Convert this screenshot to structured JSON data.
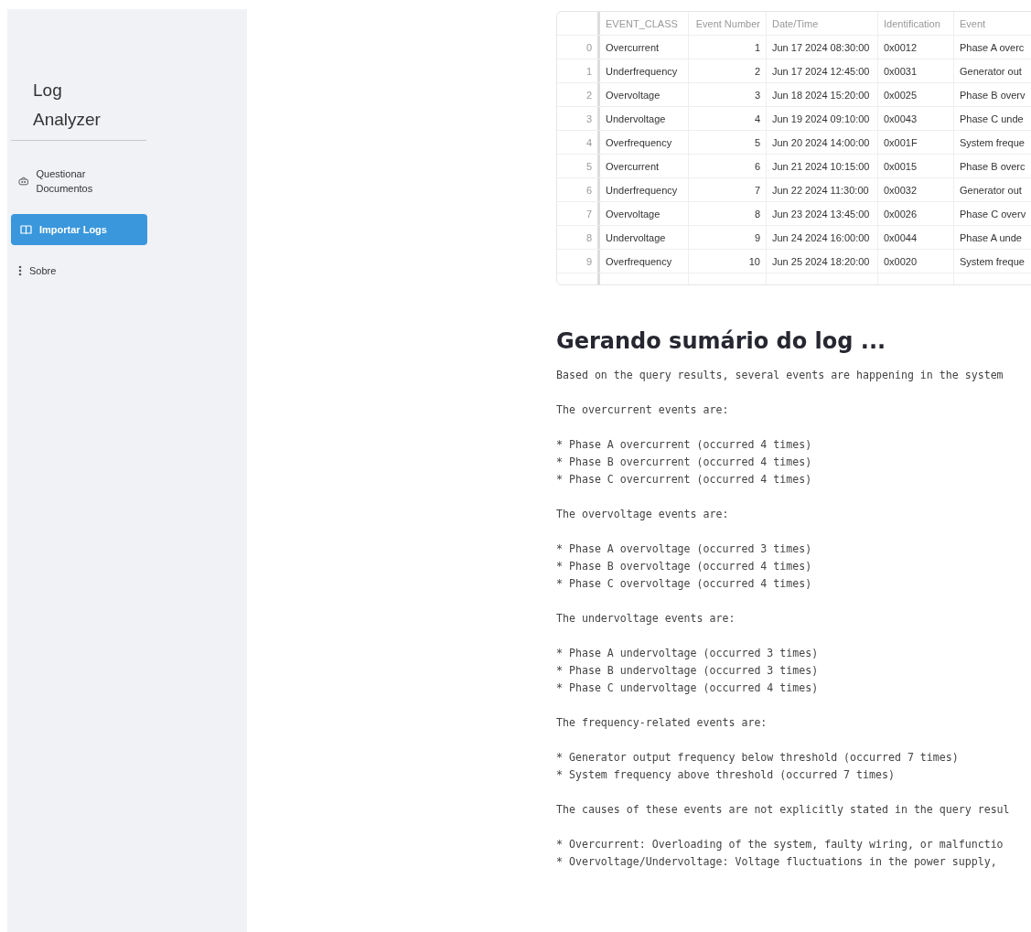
{
  "sidebar": {
    "title": "Log Analyzer",
    "items": [
      {
        "label": "Questionar Documentos",
        "kind": "robot",
        "selected": false
      },
      {
        "label": "Importar Logs",
        "kind": "book",
        "selected": true
      },
      {
        "label": "Sobre",
        "kind": "dots",
        "selected": false
      }
    ]
  },
  "table": {
    "columns": [
      "EVENT_CLASS",
      "Event Number",
      "Date/Time",
      "Identification",
      "Event"
    ],
    "rows": [
      {
        "index": "0",
        "cells": [
          "Overcurrent",
          "1",
          "Jun 17 2024 08:30:00",
          "0x0012",
          "Phase A overc"
        ]
      },
      {
        "index": "1",
        "cells": [
          "Underfrequency",
          "2",
          "Jun 17 2024 12:45:00",
          "0x0031",
          "Generator out"
        ]
      },
      {
        "index": "2",
        "cells": [
          "Overvoltage",
          "3",
          "Jun 18 2024 15:20:00",
          "0x0025",
          "Phase B overv"
        ]
      },
      {
        "index": "3",
        "cells": [
          "Undervoltage",
          "4",
          "Jun 19 2024 09:10:00",
          "0x0043",
          "Phase C unde"
        ]
      },
      {
        "index": "4",
        "cells": [
          "Overfrequency",
          "5",
          "Jun 20 2024 14:00:00",
          "0x001F",
          "System freque"
        ]
      },
      {
        "index": "5",
        "cells": [
          "Overcurrent",
          "6",
          "Jun 21 2024 10:15:00",
          "0x0015",
          "Phase B overc"
        ]
      },
      {
        "index": "6",
        "cells": [
          "Underfrequency",
          "7",
          "Jun 22 2024 11:30:00",
          "0x0032",
          "Generator out"
        ]
      },
      {
        "index": "7",
        "cells": [
          "Overvoltage",
          "8",
          "Jun 23 2024 13:45:00",
          "0x0026",
          "Phase C overv"
        ]
      },
      {
        "index": "8",
        "cells": [
          "Undervoltage",
          "9",
          "Jun 24 2024 16:00:00",
          "0x0044",
          "Phase A unde"
        ]
      },
      {
        "index": "9",
        "cells": [
          "Overfrequency",
          "10",
          "Jun 25 2024 18:20:00",
          "0x0020",
          "System freque"
        ]
      }
    ]
  },
  "summary": {
    "heading": "Gerando sumário do log ...",
    "blocks": [
      {
        "kind": "paragraph",
        "text": "Based on the query results, several events are happening in the system"
      },
      {
        "kind": "paragraph",
        "text": "The overcurrent events are:"
      },
      {
        "kind": "list",
        "items": [
          "* Phase A overcurrent (occurred 4 times)",
          "* Phase B overcurrent (occurred 4 times)",
          "* Phase C overcurrent (occurred 4 times)"
        ]
      },
      {
        "kind": "paragraph",
        "text": "The overvoltage events are:"
      },
      {
        "kind": "list",
        "items": [
          "* Phase A overvoltage (occurred 3 times)",
          "* Phase B overvoltage (occurred 4 times)",
          "* Phase C overvoltage (occurred 4 times)"
        ]
      },
      {
        "kind": "paragraph",
        "text": "The undervoltage events are:"
      },
      {
        "kind": "list",
        "items": [
          "* Phase A undervoltage (occurred 3 times)",
          "* Phase B undervoltage (occurred 3 times)",
          "* Phase C undervoltage (occurred 4 times)"
        ]
      },
      {
        "kind": "paragraph",
        "text": "The frequency-related events are:"
      },
      {
        "kind": "list",
        "items": [
          "* Generator output frequency below threshold (occurred 7 times)",
          "* System frequency above threshold (occurred 7 times)"
        ]
      },
      {
        "kind": "paragraph",
        "text": "The causes of these events are not explicitly stated in the query resul"
      },
      {
        "kind": "list",
        "items": [
          "* Overcurrent: Overloading of the system, faulty wiring, or malfunctio",
          "* Overvoltage/Undervoltage: Voltage fluctuations in the power supply,"
        ]
      }
    ]
  }
}
